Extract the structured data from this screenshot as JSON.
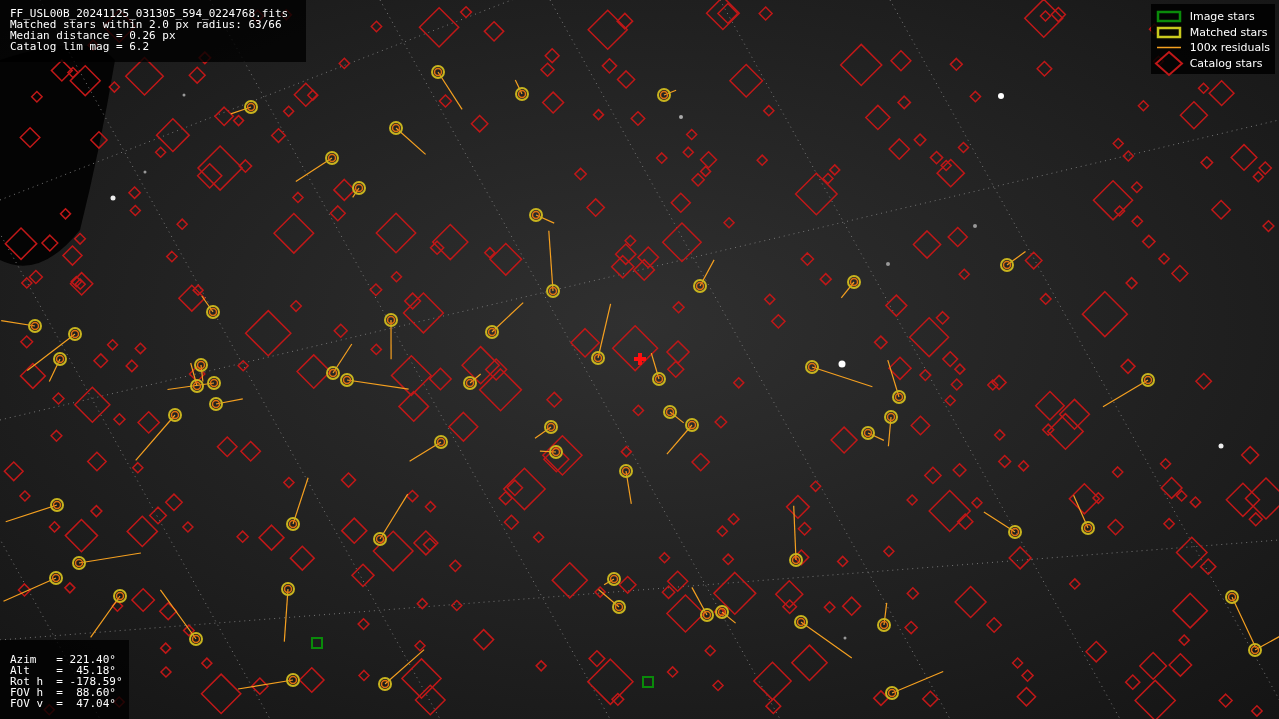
{
  "file_info": {
    "lines": [
      "FF_USL00B_20241125_031305_594_0224768.fits",
      "Matched stars within 2.0 px radius: 63/66",
      "Median distance = 0.26 px",
      "Catalog lim mag = 6.2"
    ]
  },
  "legend": {
    "items": [
      {
        "label": "Image stars",
        "kind": "image"
      },
      {
        "label": "Matched stars",
        "kind": "matched"
      },
      {
        "label": "100x residuals",
        "kind": "residual"
      },
      {
        "label": "Catalog stars",
        "kind": "catalog"
      }
    ]
  },
  "pointing": {
    "lines": [
      "Azim   = 221.40°",
      "Alt    =  45.18°",
      "Rot h  = -178.59°",
      "FOV h  =  88.60°",
      "FOV v  =  47.04°"
    ]
  }
}
